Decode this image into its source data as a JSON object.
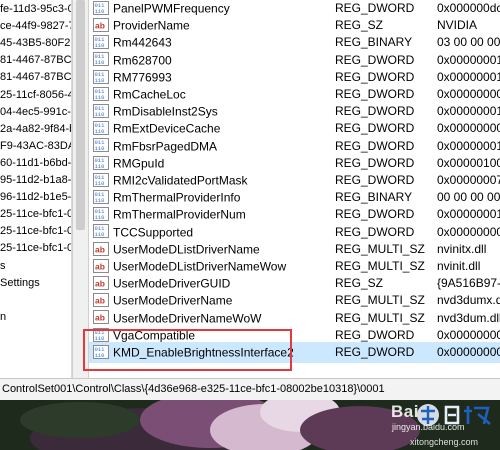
{
  "tree": {
    "items": [
      "fe-11d3-95c3-0",
      "ce-44f9-9827-7",
      "45-43B5-80F2-",
      "81-4467-87BC-",
      "81-4467-87BC-",
      "25-11cf-8056-4",
      "04-4ec5-991c-d",
      "2a-4a82-9f84-b",
      "F9-43AC-83DA-",
      "60-11d1-b6bd-",
      "95-11d2-b1a8-",
      "96-11d2-b1e5-0",
      "25-11ce-bfc1-0",
      "25-11ce-bfc1-0",
      "25-11ce-bfc1-0",
      "s",
      "Settings",
      "",
      "n"
    ]
  },
  "list": {
    "rows": [
      {
        "icon": "binary-value-icon",
        "name": "PanelPWMFrequency",
        "type": "REG_DWORD",
        "data": "0x000000dc (2"
      },
      {
        "icon": "string-value-icon",
        "name": "ProviderName",
        "type": "REG_SZ",
        "data": "NVIDIA"
      },
      {
        "icon": "binary-value-icon",
        "name": "Rm442643",
        "type": "REG_BINARY",
        "data": "03 00 00 00 30"
      },
      {
        "icon": "binary-value-icon",
        "name": "Rm628700",
        "type": "REG_DWORD",
        "data": "0x00000001 (1"
      },
      {
        "icon": "binary-value-icon",
        "name": "RM776993",
        "type": "REG_DWORD",
        "data": "0x00000001 (1"
      },
      {
        "icon": "binary-value-icon",
        "name": "RmCacheLoc",
        "type": "REG_DWORD",
        "data": "0x00000000 (0"
      },
      {
        "icon": "binary-value-icon",
        "name": "RmDisableInst2Sys",
        "type": "REG_DWORD",
        "data": "0x00000001 (1"
      },
      {
        "icon": "binary-value-icon",
        "name": "RmExtDeviceCache",
        "type": "REG_DWORD",
        "data": "0x00000000 (0"
      },
      {
        "icon": "binary-value-icon",
        "name": "RmFbsrPagedDMA",
        "type": "REG_DWORD",
        "data": "0x00000001 (1"
      },
      {
        "icon": "binary-value-icon",
        "name": "RMGpuId",
        "type": "REG_DWORD",
        "data": "0x00000100 (2"
      },
      {
        "icon": "binary-value-icon",
        "name": "RMI2cValidatedPortMask",
        "type": "REG_DWORD",
        "data": "0x00000007 (7"
      },
      {
        "icon": "binary-value-icon",
        "name": "RmThermalProviderInfo",
        "type": "REG_BINARY",
        "data": "00 00 00 00 00"
      },
      {
        "icon": "binary-value-icon",
        "name": "RmThermalProviderNum",
        "type": "REG_DWORD",
        "data": "0x00000001 (1"
      },
      {
        "icon": "binary-value-icon",
        "name": "TCCSupported",
        "type": "REG_DWORD",
        "data": "0x00000000 (0"
      },
      {
        "icon": "string-value-icon",
        "name": "UserModeDListDriverName",
        "type": "REG_MULTI_SZ",
        "data": "nvinitx.dll"
      },
      {
        "icon": "string-value-icon",
        "name": "UserModeDListDriverNameWow",
        "type": "REG_MULTI_SZ",
        "data": "nvinit.dll"
      },
      {
        "icon": "string-value-icon",
        "name": "UserModeDriverGUID",
        "type": "REG_SZ",
        "data": "{9A516B97-E7"
      },
      {
        "icon": "string-value-icon",
        "name": "UserModeDriverName",
        "type": "REG_MULTI_SZ",
        "data": "nvd3dumx.dll"
      },
      {
        "icon": "string-value-icon",
        "name": "UserModeDriverNameWoW",
        "type": "REG_MULTI_SZ",
        "data": "nvd3dum.dll nv"
      },
      {
        "icon": "binary-value-icon",
        "name": "VgaCompatible",
        "type": "REG_DWORD",
        "data": "0x00000000 (0"
      },
      {
        "icon": "binary-value-icon",
        "name": "KMD_EnableBrightnessInterface2",
        "type": "REG_DWORD",
        "data": "0x00000000 (0",
        "selected": true
      }
    ]
  },
  "statusbar": {
    "path": "ControlSet001\\Control\\Class\\{4d36e968-e325-11ce-bfc1-08002be10318}\\0001"
  },
  "watermark": {
    "brand": "Bai",
    "url_top": "jingyan.baidu.com",
    "url_bottom": "xitongcheng.com"
  },
  "colors": {
    "selection": "#cce8ff",
    "highlight_box": "#e23a3a",
    "binary_icon": "#2f6fd0",
    "string_icon": "#c0392b"
  }
}
